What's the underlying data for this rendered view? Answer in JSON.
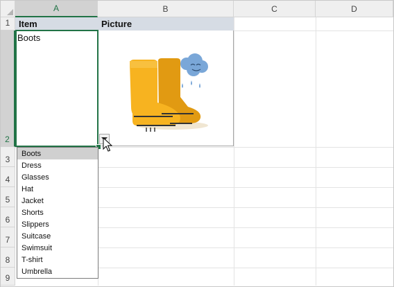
{
  "columns": [
    "A",
    "B",
    "C",
    "D"
  ],
  "rows": [
    "1",
    "2",
    "3",
    "4",
    "5",
    "6",
    "7",
    "8",
    "9"
  ],
  "header_row": {
    "item": "Item",
    "picture": "Picture"
  },
  "active_cell_value": "Boots",
  "dropdown": {
    "selected_index": 0,
    "options": [
      "Boots",
      "Dress",
      "Glasses",
      "Hat",
      "Jacket",
      "Shorts",
      "Slippers",
      "Suitcase",
      "Swimsuit",
      "T-shirt",
      "Umbrella"
    ]
  },
  "colors": {
    "accent_green": "#217346",
    "header_fill": "#d6dce4",
    "boot_yellow": "#f7b320",
    "boot_dark": "#e19a12",
    "cloud_blue": "#7aa7d8"
  },
  "image": {
    "name": "boots-picture"
  }
}
